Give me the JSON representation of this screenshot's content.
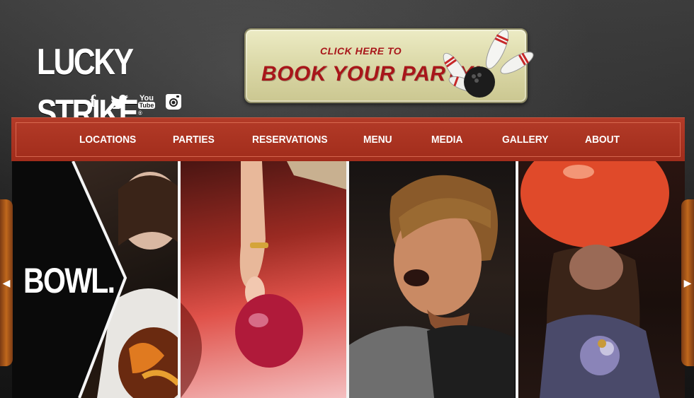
{
  "header": {
    "logo_text": "LUCKY STRIKE",
    "logo_mark": "®",
    "social": [
      {
        "name": "facebook-icon",
        "glyph": "f"
      },
      {
        "name": "twitter-icon",
        "glyph": ""
      },
      {
        "name": "youtube-icon",
        "glyph_top": "You",
        "glyph_bottom": "Tube"
      },
      {
        "name": "instagram-icon",
        "glyph": ""
      }
    ]
  },
  "promo": {
    "small": "CLICK HERE TO",
    "big": "BOOK YOUR PARTY!"
  },
  "nav": {
    "items": [
      "LOCATIONS",
      "PARTIES",
      "RESERVATIONS",
      "MENU",
      "MEDIA",
      "GALLERY",
      "ABOUT"
    ]
  },
  "hero": {
    "caption": "BOWL.",
    "prev_glyph": "◀",
    "next_glyph": "▶"
  },
  "colors": {
    "nav_red": "#a12c1b",
    "promo_text": "#a8161a",
    "promo_bg": "#dcd9a8"
  }
}
